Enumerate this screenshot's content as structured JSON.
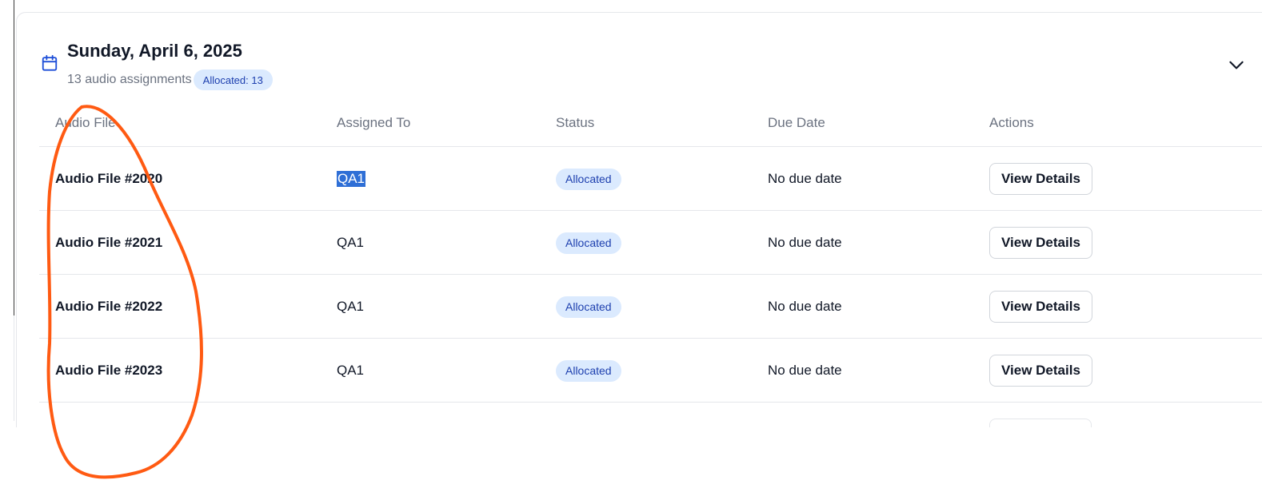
{
  "group": {
    "date_title": "Sunday, April 6, 2025",
    "count_text": "13 audio assignments",
    "allocated_badge": "Allocated: 13",
    "icons": {
      "calendar": "calendar-icon",
      "collapse": "chevron-down-icon"
    }
  },
  "table": {
    "headers": {
      "audio_file": "Audio File",
      "assigned_to": "Assigned To",
      "status": "Status",
      "due_date": "Due Date",
      "actions": "Actions"
    },
    "rows": [
      {
        "audio_file": "Audio File #2020",
        "assigned_to": "QA1",
        "assigned_selected": true,
        "status": "Allocated",
        "due_date": "No due date",
        "action": "View Details"
      },
      {
        "audio_file": "Audio File #2021",
        "assigned_to": "QA1",
        "status": "Allocated",
        "due_date": "No due date",
        "action": "View Details"
      },
      {
        "audio_file": "Audio File #2022",
        "assigned_to": "QA1",
        "status": "Allocated",
        "due_date": "No due date",
        "action": "View Details"
      },
      {
        "audio_file": "Audio File #2023",
        "assigned_to": "QA1",
        "status": "Allocated",
        "due_date": "No due date",
        "action": "View Details"
      }
    ]
  },
  "colors": {
    "badge_bg": "#dbeafe",
    "badge_text": "#1e40af",
    "accent_icon": "#1d4ed8",
    "selection": "#2f6fd6",
    "annotation_stroke": "#ff5a12"
  }
}
